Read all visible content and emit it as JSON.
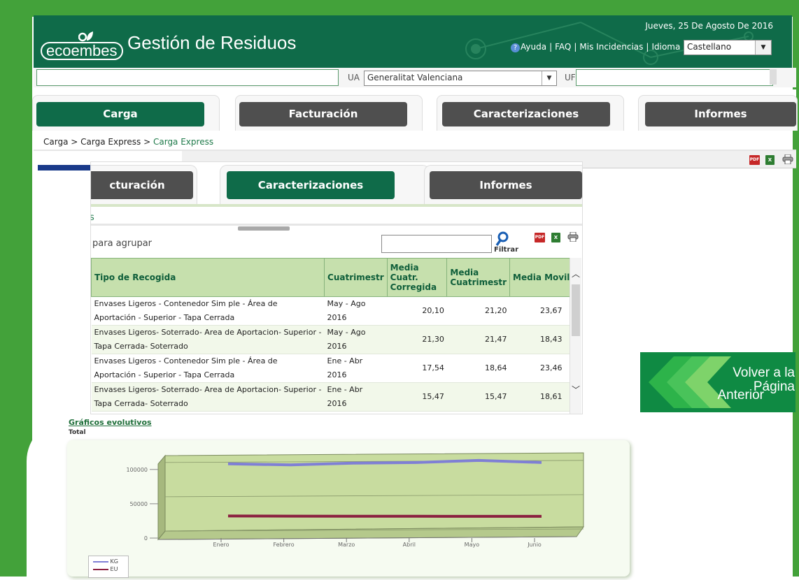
{
  "header": {
    "logo_text": "ecoembes",
    "app_title": "Gestión de Residuos",
    "date": "Jueves, 25 De Agosto De 2016",
    "links": [
      "Ayuda",
      "FAQ",
      "Mis Incidencias",
      "Idioma"
    ],
    "language_value": "Castellano"
  },
  "filters": {
    "ua_label": "UA",
    "ua_value": "Generalitat Valenciana",
    "uf_label": "UF"
  },
  "tabs": [
    {
      "label": "Carga",
      "active": true
    },
    {
      "label": "Facturación",
      "active": false
    },
    {
      "label": "Caracterizaciones",
      "active": false
    },
    {
      "label": "Informes",
      "active": false
    }
  ],
  "breadcrumb": {
    "part1": "Carga",
    "sep": ">",
    "part2": "Carga Express",
    "current": "Carga Express"
  },
  "toolbar_icons": [
    "pdf-icon",
    "excel-icon",
    "print-icon"
  ],
  "panel": {
    "tabs": [
      {
        "label": "cturación",
        "active": false
      },
      {
        "label": "Caracterizaciones",
        "active": true
      },
      {
        "label": "Informes",
        "active": false
      }
    ],
    "s_text": "s",
    "group_text": "para agrupar",
    "filter_label": "Filtrar",
    "columns": [
      "Tipo de Recogida",
      "Cuatrimestr",
      "Media Cuatr. Corregida",
      "Media Cuatrimestr",
      "Media Movil"
    ],
    "rows": [
      {
        "tipo": "Envases Ligeros - Contenedor Sim ple - Área de Aportación - Superior - Tapa Cerrada",
        "cuatr": "May - Ago 2016",
        "corr": "20,10",
        "media": "21,20",
        "movil": "23,67"
      },
      {
        "tipo": "Envases Ligeros- Soterrado- Area de Aportacion- Superior - Tapa Cerrada- Soterrado",
        "cuatr": "May - Ago 2016",
        "corr": "21,30",
        "media": "21,47",
        "movil": "18,43"
      },
      {
        "tipo": "Envases Ligeros - Contenedor Sim ple - Área de Aportación - Superior - Tapa Cerrada",
        "cuatr": "Ene - Abr 2016",
        "corr": "17,54",
        "media": "18,64",
        "movil": "23,46"
      },
      {
        "tipo": "Envases Ligeros- Soterrado- Area de Aportacion- Superior - Tapa Cerrada- Soterrado",
        "cuatr": "Ene - Abr 2016",
        "corr": "15,47",
        "media": "15,47",
        "movil": "18,61"
      }
    ]
  },
  "back_button": {
    "line1": "Volver a la",
    "line2": "Página",
    "line3": "Anterior"
  },
  "chart_title": "Gráficos evolutivos",
  "chart_subtitle": "Total",
  "chart_data": {
    "type": "line",
    "categories": [
      "Enero",
      "Febrero",
      "Marzo",
      "Abril",
      "Mayo",
      "Junio"
    ],
    "series": [
      {
        "name": "KG",
        "color": "#7f7fd5",
        "values": [
          98000,
          96500,
          99000,
          100000,
          103000,
          100000
        ]
      },
      {
        "name": "EU",
        "color": "#8b2040",
        "values": [
          22000,
          21800,
          21700,
          21600,
          21500,
          21500
        ]
      }
    ],
    "yticks": [
      "0",
      "50000",
      "100000"
    ],
    "ylim": [
      0,
      110000
    ],
    "grid": true,
    "legend": "bottom-left"
  }
}
